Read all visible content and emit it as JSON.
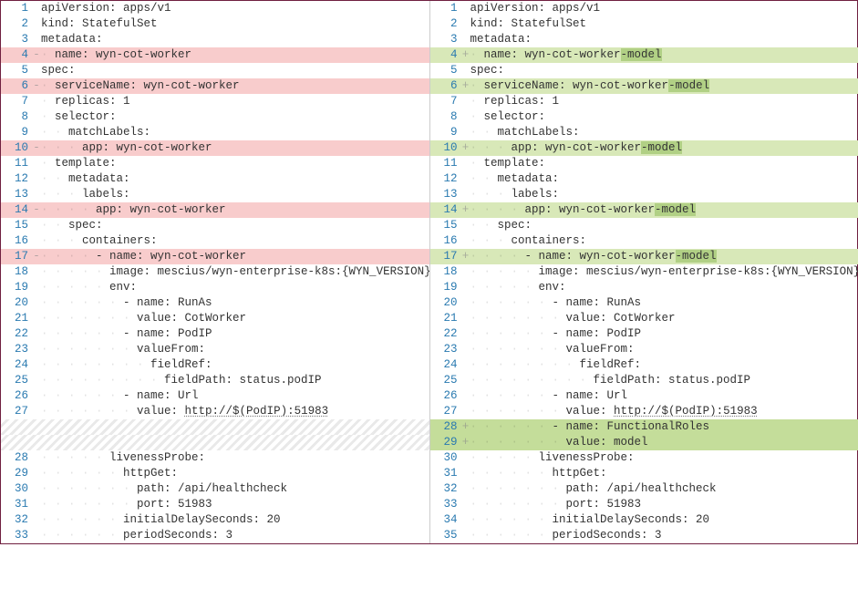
{
  "left": [
    {
      "ln": "1",
      "sign": "",
      "cls": "",
      "indent": 0,
      "text": "apiVersion: apps/v1"
    },
    {
      "ln": "2",
      "sign": "",
      "cls": "",
      "indent": 0,
      "text": "kind: StatefulSet"
    },
    {
      "ln": "3",
      "sign": "",
      "cls": "",
      "indent": 0,
      "text": "metadata:"
    },
    {
      "ln": "4",
      "sign": "-",
      "cls": "row--mod-left",
      "indent": 1,
      "text": "name: wyn-cot-worker"
    },
    {
      "ln": "5",
      "sign": "",
      "cls": "",
      "indent": 0,
      "text": "spec:"
    },
    {
      "ln": "6",
      "sign": "-",
      "cls": "row--mod-left",
      "indent": 1,
      "text": "serviceName: wyn-cot-worker"
    },
    {
      "ln": "7",
      "sign": "",
      "cls": "",
      "indent": 1,
      "text": "replicas: 1"
    },
    {
      "ln": "8",
      "sign": "",
      "cls": "",
      "indent": 1,
      "text": "selector:"
    },
    {
      "ln": "9",
      "sign": "",
      "cls": "",
      "indent": 2,
      "text": "matchLabels:"
    },
    {
      "ln": "10",
      "sign": "-",
      "cls": "row--mod-left",
      "indent": 3,
      "text": "app: wyn-cot-worker"
    },
    {
      "ln": "11",
      "sign": "",
      "cls": "",
      "indent": 1,
      "text": "template:"
    },
    {
      "ln": "12",
      "sign": "",
      "cls": "",
      "indent": 2,
      "text": "metadata:"
    },
    {
      "ln": "13",
      "sign": "",
      "cls": "",
      "indent": 3,
      "text": "labels:"
    },
    {
      "ln": "14",
      "sign": "-",
      "cls": "row--mod-left",
      "indent": 4,
      "text": "app: wyn-cot-worker"
    },
    {
      "ln": "15",
      "sign": "",
      "cls": "",
      "indent": 2,
      "text": "spec:"
    },
    {
      "ln": "16",
      "sign": "",
      "cls": "",
      "indent": 3,
      "text": "containers:"
    },
    {
      "ln": "17",
      "sign": "-",
      "cls": "row--mod-left",
      "indent": 4,
      "text": "- name: wyn-cot-worker"
    },
    {
      "ln": "18",
      "sign": "",
      "cls": "",
      "indent": 5,
      "text": "image: mescius/wyn-enterprise-k8s:{WYN_VERSION}"
    },
    {
      "ln": "19",
      "sign": "",
      "cls": "",
      "indent": 5,
      "text": "env:"
    },
    {
      "ln": "20",
      "sign": "",
      "cls": "",
      "indent": 6,
      "text": "- name: RunAs"
    },
    {
      "ln": "21",
      "sign": "",
      "cls": "",
      "indent": 7,
      "text": "value: CotWorker"
    },
    {
      "ln": "22",
      "sign": "",
      "cls": "",
      "indent": 6,
      "text": "- name: PodIP"
    },
    {
      "ln": "23",
      "sign": "",
      "cls": "",
      "indent": 7,
      "text": "valueFrom:"
    },
    {
      "ln": "24",
      "sign": "",
      "cls": "",
      "indent": 8,
      "text": "fieldRef:"
    },
    {
      "ln": "25",
      "sign": "",
      "cls": "",
      "indent": 9,
      "text": "fieldPath: status.podIP"
    },
    {
      "ln": "26",
      "sign": "",
      "cls": "",
      "indent": 6,
      "text": "- name: Url"
    },
    {
      "ln": "27",
      "sign": "",
      "cls": "",
      "indent": 7,
      "text": "value: ",
      "url": "http://$(PodIP):51983"
    },
    {
      "ln": "",
      "sign": "",
      "cls": "row--placeholder",
      "indent": 0,
      "text": ""
    },
    {
      "ln": "",
      "sign": "",
      "cls": "row--placeholder",
      "indent": 0,
      "text": ""
    },
    {
      "ln": "28",
      "sign": "",
      "cls": "",
      "indent": 5,
      "text": "livenessProbe:"
    },
    {
      "ln": "29",
      "sign": "",
      "cls": "",
      "indent": 6,
      "text": "httpGet:"
    },
    {
      "ln": "30",
      "sign": "",
      "cls": "",
      "indent": 7,
      "text": "path: /api/healthcheck"
    },
    {
      "ln": "31",
      "sign": "",
      "cls": "",
      "indent": 7,
      "text": "port: 51983"
    },
    {
      "ln": "32",
      "sign": "",
      "cls": "",
      "indent": 6,
      "text": "initialDelaySeconds: 20"
    },
    {
      "ln": "33",
      "sign": "",
      "cls": "",
      "indent": 6,
      "text": "periodSeconds: 3"
    }
  ],
  "right": [
    {
      "ln": "1",
      "sign": "",
      "cls": "",
      "indent": 0,
      "text": "apiVersion: apps/v1"
    },
    {
      "ln": "2",
      "sign": "",
      "cls": "",
      "indent": 0,
      "text": "kind: StatefulSet"
    },
    {
      "ln": "3",
      "sign": "",
      "cls": "",
      "indent": 0,
      "text": "metadata:"
    },
    {
      "ln": "4",
      "sign": "+",
      "cls": "row--mod-right",
      "indent": 1,
      "text": "name: wyn-cot-worker",
      "suffix": "-model"
    },
    {
      "ln": "5",
      "sign": "",
      "cls": "",
      "indent": 0,
      "text": "spec:"
    },
    {
      "ln": "6",
      "sign": "+",
      "cls": "row--mod-right",
      "indent": 1,
      "text": "serviceName: wyn-cot-worker",
      "suffix": "-model"
    },
    {
      "ln": "7",
      "sign": "",
      "cls": "",
      "indent": 1,
      "text": "replicas: 1"
    },
    {
      "ln": "8",
      "sign": "",
      "cls": "",
      "indent": 1,
      "text": "selector:"
    },
    {
      "ln": "9",
      "sign": "",
      "cls": "",
      "indent": 2,
      "text": "matchLabels:"
    },
    {
      "ln": "10",
      "sign": "+",
      "cls": "row--mod-right",
      "indent": 3,
      "text": "app: wyn-cot-worker",
      "suffix": "-model"
    },
    {
      "ln": "11",
      "sign": "",
      "cls": "",
      "indent": 1,
      "text": "template:"
    },
    {
      "ln": "12",
      "sign": "",
      "cls": "",
      "indent": 2,
      "text": "metadata:"
    },
    {
      "ln": "13",
      "sign": "",
      "cls": "",
      "indent": 3,
      "text": "labels:"
    },
    {
      "ln": "14",
      "sign": "+",
      "cls": "row--mod-right",
      "indent": 4,
      "text": "app: wyn-cot-worker",
      "suffix": "-model"
    },
    {
      "ln": "15",
      "sign": "",
      "cls": "",
      "indent": 2,
      "text": "spec:"
    },
    {
      "ln": "16",
      "sign": "",
      "cls": "",
      "indent": 3,
      "text": "containers:"
    },
    {
      "ln": "17",
      "sign": "+",
      "cls": "row--mod-right",
      "indent": 4,
      "text": "- name: wyn-cot-worker",
      "suffix": "-model"
    },
    {
      "ln": "18",
      "sign": "",
      "cls": "",
      "indent": 5,
      "text": "image: mescius/wyn-enterprise-k8s:{WYN_VERSION}"
    },
    {
      "ln": "19",
      "sign": "",
      "cls": "",
      "indent": 5,
      "text": "env:"
    },
    {
      "ln": "20",
      "sign": "",
      "cls": "",
      "indent": 6,
      "text": "- name: RunAs"
    },
    {
      "ln": "21",
      "sign": "",
      "cls": "",
      "indent": 7,
      "text": "value: CotWorker"
    },
    {
      "ln": "22",
      "sign": "",
      "cls": "",
      "indent": 6,
      "text": "- name: PodIP"
    },
    {
      "ln": "23",
      "sign": "",
      "cls": "",
      "indent": 7,
      "text": "valueFrom:"
    },
    {
      "ln": "24",
      "sign": "",
      "cls": "",
      "indent": 8,
      "text": "fieldRef:"
    },
    {
      "ln": "25",
      "sign": "",
      "cls": "",
      "indent": 9,
      "text": "fieldPath: status.podIP"
    },
    {
      "ln": "26",
      "sign": "",
      "cls": "",
      "indent": 6,
      "text": "- name: Url"
    },
    {
      "ln": "27",
      "sign": "",
      "cls": "",
      "indent": 7,
      "text": "value: ",
      "url": "http://$(PodIP):51983"
    },
    {
      "ln": "28",
      "sign": "+",
      "cls": "row--add-right",
      "indent": 6,
      "text": "- name: FunctionalRoles"
    },
    {
      "ln": "29",
      "sign": "+",
      "cls": "row--add-right",
      "indent": 7,
      "text": "value: model"
    },
    {
      "ln": "30",
      "sign": "",
      "cls": "",
      "indent": 5,
      "text": "livenessProbe:"
    },
    {
      "ln": "31",
      "sign": "",
      "cls": "",
      "indent": 6,
      "text": "httpGet:"
    },
    {
      "ln": "32",
      "sign": "",
      "cls": "",
      "indent": 7,
      "text": "path: /api/healthcheck"
    },
    {
      "ln": "33",
      "sign": "",
      "cls": "",
      "indent": 7,
      "text": "port: 51983"
    },
    {
      "ln": "34",
      "sign": "",
      "cls": "",
      "indent": 6,
      "text": "initialDelaySeconds: 20"
    },
    {
      "ln": "35",
      "sign": "",
      "cls": "",
      "indent": 6,
      "text": "periodSeconds: 3"
    }
  ]
}
